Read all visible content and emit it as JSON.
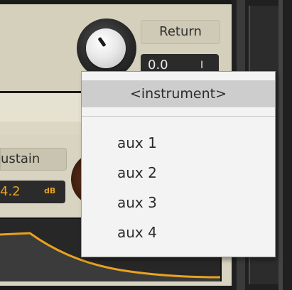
{
  "return": {
    "label": "Return",
    "value": "0.0",
    "caret": "I"
  },
  "sustain": {
    "label": "ustain",
    "value": "4.2",
    "unit": "dB"
  },
  "menu": {
    "selected": "<instrument>",
    "items": [
      "aux 1",
      "aux 2",
      "aux 3",
      "aux 4"
    ]
  },
  "colors": {
    "accent": "#e8a31e",
    "panel": "#dcd7c4",
    "menu_bg": "#f3f3f3",
    "menu_highlight": "#cdcdcd"
  }
}
